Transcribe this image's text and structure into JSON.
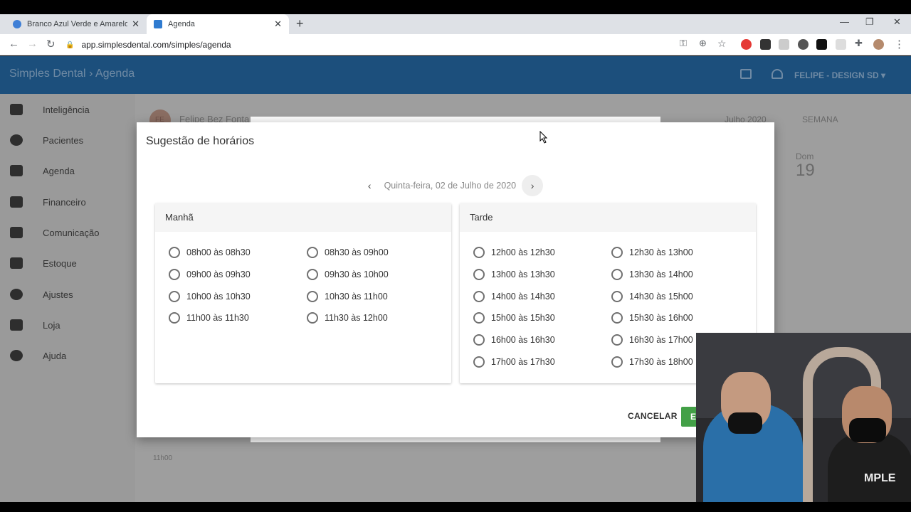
{
  "browser": {
    "tabs": [
      {
        "title": "Branco Azul Verde e Amarelo Mo",
        "active": false
      },
      {
        "title": "Agenda",
        "active": true
      }
    ],
    "url": "app.simplesdental.com/simples/agenda"
  },
  "app": {
    "brand": "Simples Dental",
    "section": "Agenda",
    "user": "FELIPE - DESIGN SD",
    "sidebar": [
      "Inteligência",
      "Pacientes",
      "Agenda",
      "Financeiro",
      "Comunicação",
      "Estoque",
      "Ajustes",
      "Loja",
      "Ajuda"
    ],
    "bg": {
      "patient": "Felipe Bez Fonta",
      "initials": "FE",
      "month": "Julho 2020",
      "view": "SEMANA",
      "day_name": "Dom",
      "day_num": "19",
      "time": "11h00"
    }
  },
  "modal": {
    "title": "Sugestão de horários",
    "date": "Quinta-feira, 02 de Julho de 2020",
    "morning": {
      "title": "Manhã",
      "slots": [
        "08h00 às 08h30",
        "08h30 às 09h00",
        "09h00 às 09h30",
        "09h30 às 10h00",
        "10h00 às 10h30",
        "10h30 às 11h00",
        "11h00 às 11h30",
        "11h30 às 12h00"
      ]
    },
    "afternoon": {
      "title": "Tarde",
      "slots": [
        "12h00 às 12h30",
        "12h30 às 13h00",
        "13h00 às 13h30",
        "13h30 às 14h00",
        "14h00 às 14h30",
        "14h30 às 15h00",
        "15h00 às 15h30",
        "15h30 às 16h00",
        "16h00 às 16h30",
        "16h30 às 17h00",
        "17h00 às 17h30",
        "17h30 às 18h00"
      ]
    },
    "cancel_label": "CANCELAR",
    "ok_label": "E"
  },
  "webcam": {
    "shirt_text": "MPLE"
  },
  "colors": {
    "header": "#1c4f7c",
    "confirm": "#43a047"
  }
}
